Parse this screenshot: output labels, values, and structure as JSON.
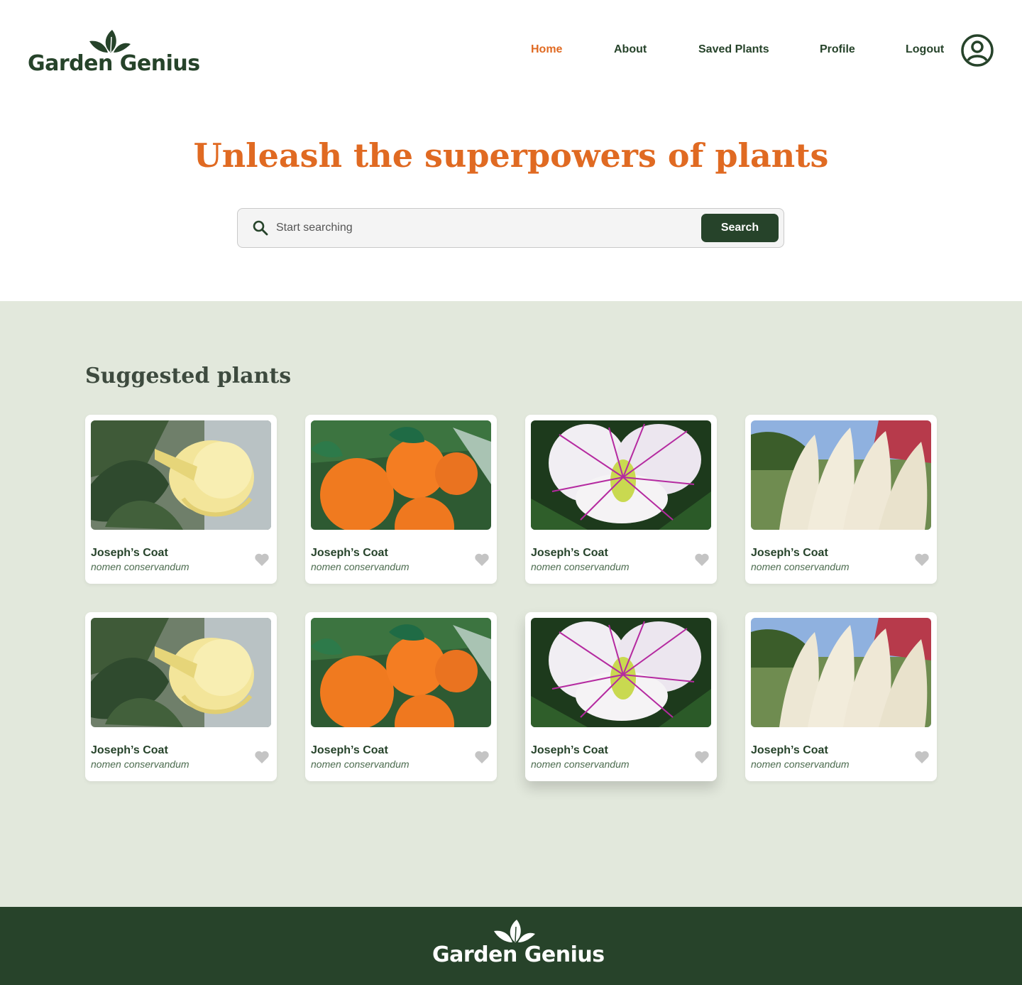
{
  "brand": {
    "name": "Garden Genius"
  },
  "nav": {
    "items": [
      {
        "label": "Home",
        "active": true
      },
      {
        "label": "About",
        "active": false
      },
      {
        "label": "Saved Plants",
        "active": false
      },
      {
        "label": "Profile",
        "active": false
      },
      {
        "label": "Logout",
        "active": false
      }
    ]
  },
  "hero": {
    "title": "Unleash the superpowers of plants"
  },
  "search": {
    "placeholder": "Start searching",
    "button_label": "Search"
  },
  "suggested": {
    "title": "Suggested plants",
    "cards": [
      {
        "name": "Joseph’s Coat",
        "scientific": "nomen conservandum",
        "image": "yellow-trumpet-flower"
      },
      {
        "name": "Joseph’s Coat",
        "scientific": "nomen conservandum",
        "image": "mandarin-oranges"
      },
      {
        "name": "Joseph’s Coat",
        "scientific": "nomen conservandum",
        "image": "caper-flower"
      },
      {
        "name": "Joseph’s Coat",
        "scientific": "nomen conservandum",
        "image": "pampas-grass"
      },
      {
        "name": "Joseph’s Coat",
        "scientific": "nomen conservandum",
        "image": "yellow-trumpet-flower"
      },
      {
        "name": "Joseph’s Coat",
        "scientific": "nomen conservandum",
        "image": "mandarin-oranges"
      },
      {
        "name": "Joseph’s Coat",
        "scientific": "nomen conservandum",
        "image": "caper-flower"
      },
      {
        "name": "Joseph’s Coat",
        "scientific": "nomen conservandum",
        "image": "pampas-grass"
      }
    ]
  },
  "colors": {
    "primary": "#26432a",
    "accent": "#e06a22",
    "section_bg": "#e2e8dc",
    "heart": "#c4c4c4"
  },
  "icons": {
    "search": "search-icon",
    "user": "user-circle-icon",
    "heart": "heart-icon",
    "logo": "leaves-logo-icon"
  }
}
